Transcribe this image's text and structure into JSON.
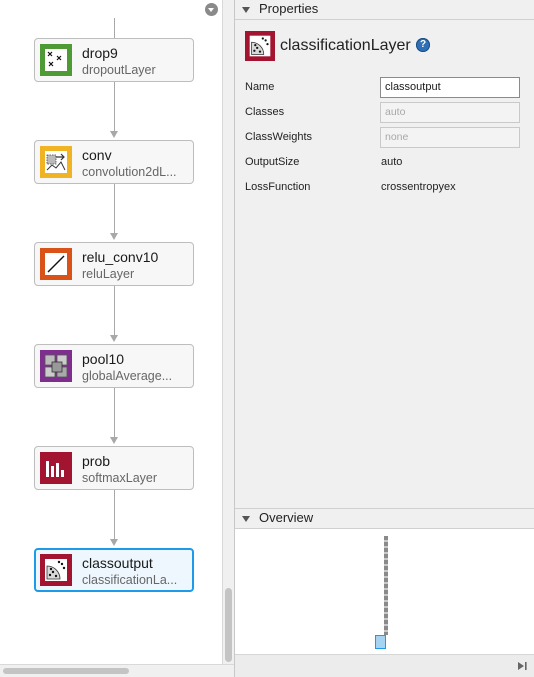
{
  "canvas": {
    "menu_icon": "chevron-down-circle-icon",
    "layers": [
      {
        "name": "drop9",
        "type": "dropoutLayer",
        "icon": "dropout-icon",
        "color": "#4e9a34"
      },
      {
        "name": "conv",
        "type": "convolution2dL...",
        "icon": "convolution-icon",
        "color": "#f0b323"
      },
      {
        "name": "relu_conv10",
        "type": "reluLayer",
        "icon": "relu-icon",
        "color": "#d95319"
      },
      {
        "name": "pool10",
        "type": "globalAverage...",
        "icon": "pooling-icon",
        "color": "#7e2f8e"
      },
      {
        "name": "prob",
        "type": "softmaxLayer",
        "icon": "softmax-icon",
        "color": "#a2142f"
      },
      {
        "name": "classoutput",
        "type": "classificationLa...",
        "icon": "classification-icon",
        "color": "#a2142f",
        "selected": true
      }
    ]
  },
  "properties": {
    "header": "Properties",
    "title": "classificationLayer",
    "help_symbol": "?",
    "rows": [
      {
        "label": "Name",
        "value": "classoutput",
        "kind": "input"
      },
      {
        "label": "Classes",
        "value": "auto",
        "kind": "disabled"
      },
      {
        "label": "ClassWeights",
        "value": "none",
        "kind": "disabled"
      },
      {
        "label": "OutputSize",
        "value": "auto",
        "kind": "text"
      },
      {
        "label": "LossFunction",
        "value": "crossentropyex",
        "kind": "text"
      }
    ]
  },
  "overview": {
    "header": "Overview"
  },
  "colors": {
    "selection": "#1e9be8",
    "help_blue": "#2f6fb5"
  }
}
